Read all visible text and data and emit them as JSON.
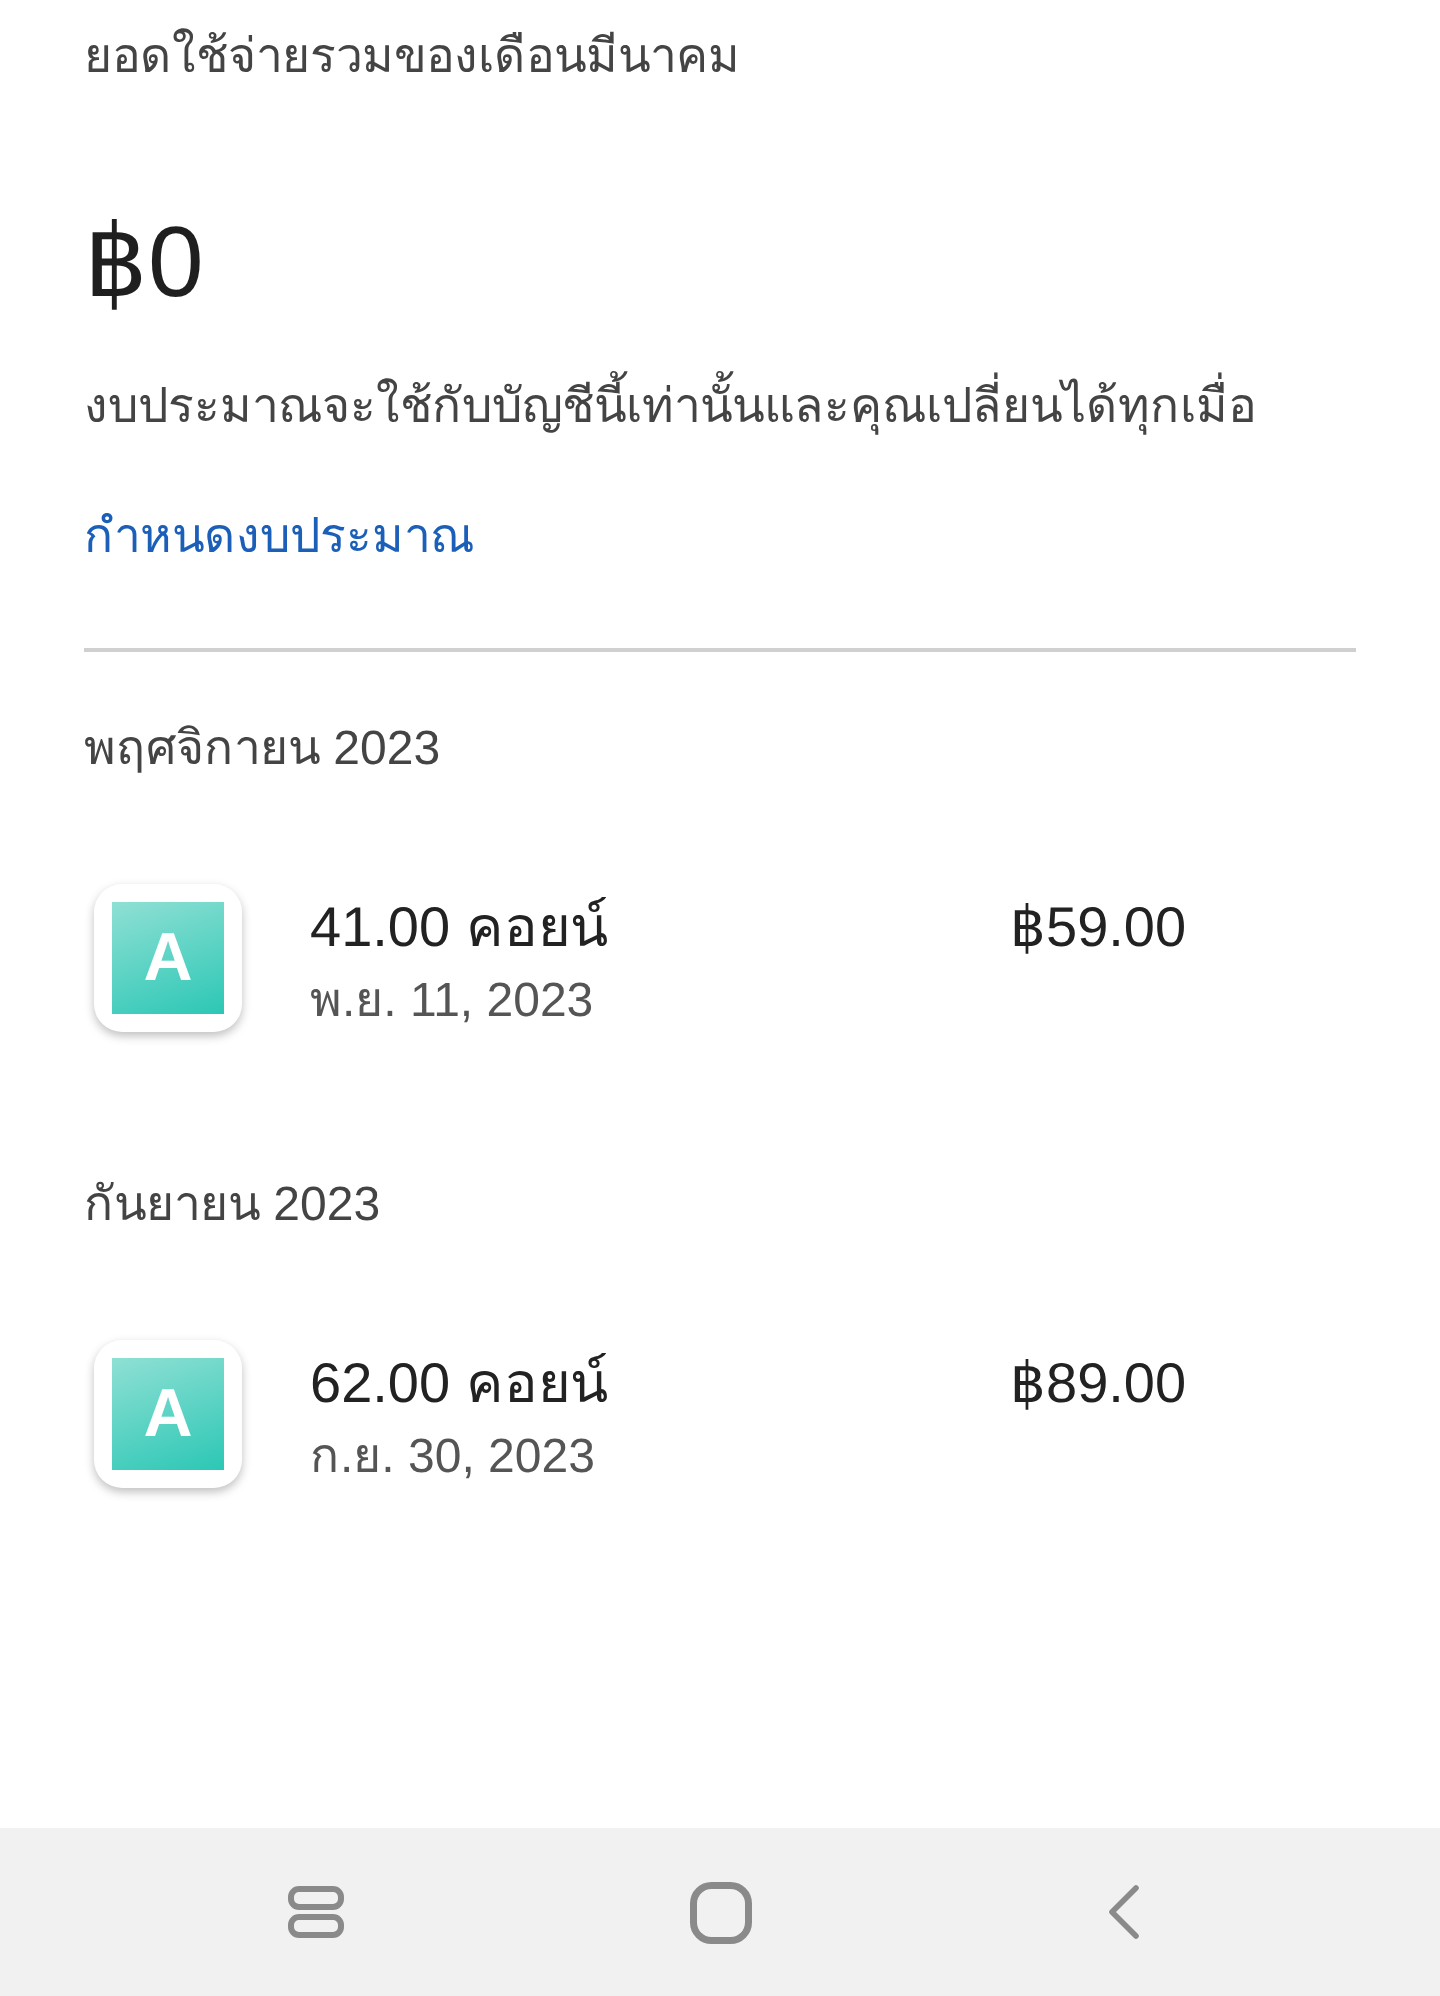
{
  "summary": {
    "label": "ยอดใช้จ่ายรวมของเดือนมีนาคม",
    "amount": "฿0",
    "note": "งบประมาณจะใช้กับบัญชีนี้เท่านั้นและคุณเปลี่ยนได้ทุกเมื่อ",
    "link": "กำหนดงบประมาณ"
  },
  "groups": [
    {
      "month": "พฤศจิกายน 2023",
      "transactions": [
        {
          "logo_letter": "A",
          "title": "41.00 คอยน์",
          "date": "พ.ย. 11, 2023",
          "price": "฿59.00"
        }
      ]
    },
    {
      "month": "กันยายน 2023",
      "transactions": [
        {
          "logo_letter": "A",
          "title": "62.00 คอยน์",
          "date": "ก.ย. 30, 2023",
          "price": "฿89.00"
        }
      ]
    }
  ],
  "nav_bar": [
    {
      "kind": "recents"
    },
    {
      "kind": "home"
    },
    {
      "kind": "back"
    }
  ]
}
